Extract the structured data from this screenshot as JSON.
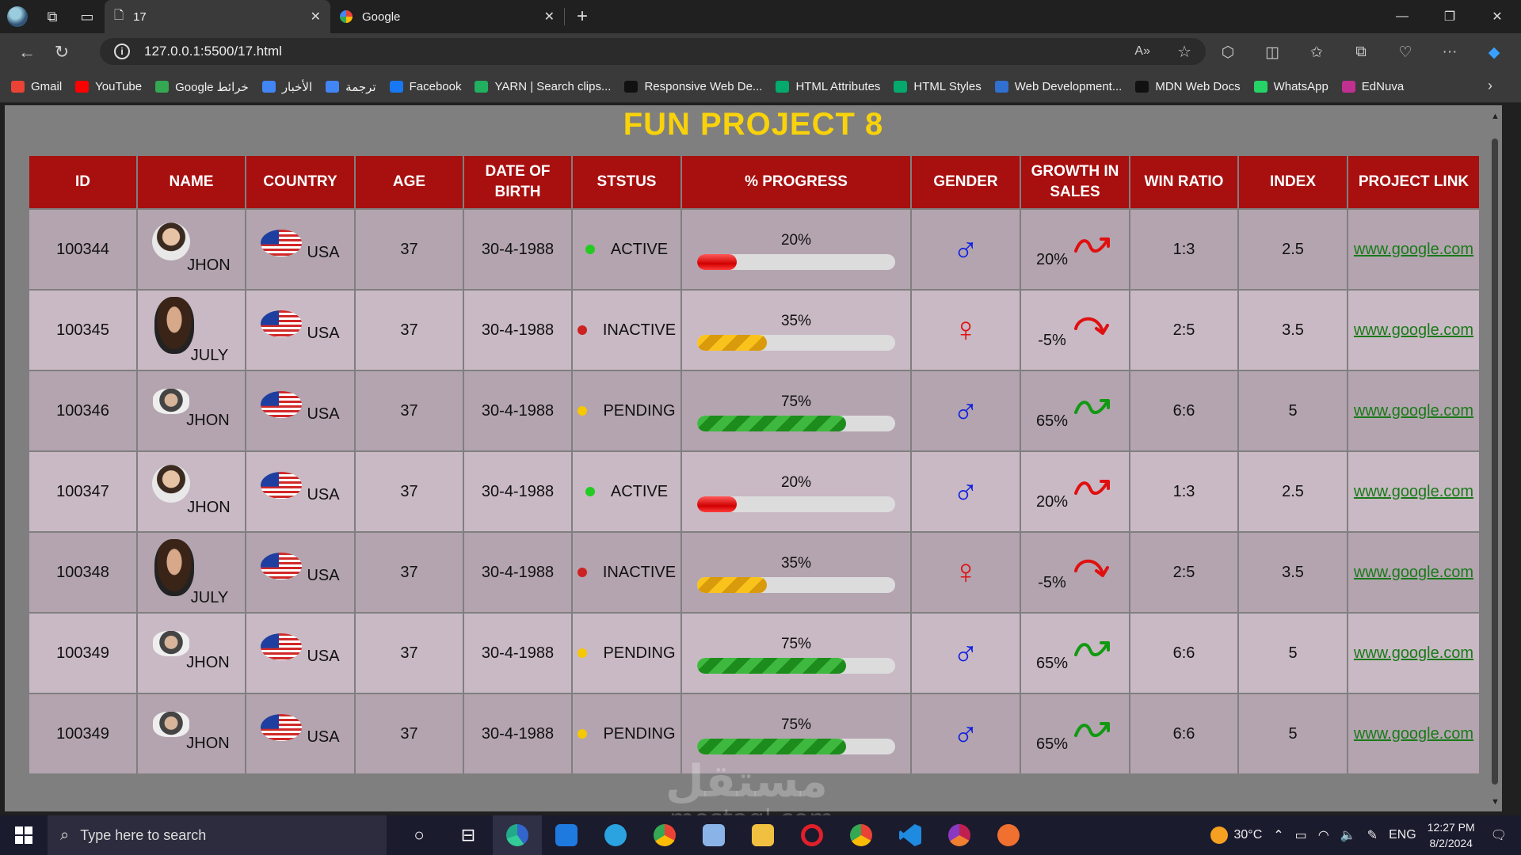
{
  "browser": {
    "tabs": [
      {
        "title": "17",
        "active": true
      },
      {
        "title": "Google",
        "active": false
      }
    ],
    "url": "127.0.0.1:5500/17.html",
    "bookmarks": [
      {
        "label": "Gmail",
        "color": "#ea4335"
      },
      {
        "label": "YouTube",
        "color": "#ff0000"
      },
      {
        "label": "Google خرائط",
        "color": "#34a853"
      },
      {
        "label": "الأخبار",
        "color": "#4285f4"
      },
      {
        "label": "ترجمة",
        "color": "#4285f4"
      },
      {
        "label": "Facebook",
        "color": "#1877f2"
      },
      {
        "label": "YARN | Search clips...",
        "color": "#20b060"
      },
      {
        "label": "Responsive Web De...",
        "color": "#111111"
      },
      {
        "label": "HTML Attributes",
        "color": "#04aa6d"
      },
      {
        "label": "HTML Styles",
        "color": "#04aa6d"
      },
      {
        "label": "Web Development...",
        "color": "#3070d0"
      },
      {
        "label": "MDN Web Docs",
        "color": "#111111"
      },
      {
        "label": "WhatsApp",
        "color": "#25d366"
      },
      {
        "label": "EdNuva",
        "color": "#c03090"
      }
    ]
  },
  "page": {
    "title": "FUN PROJECT 8",
    "headers": [
      "ID",
      "NAME",
      "COUNTRY",
      "AGE",
      "DATE OF BIRTH",
      "STSTUS",
      "% PROGRESS",
      "GENDER",
      "GROWTH IN SALES",
      "WIN RATIO",
      "INDEX",
      "PROJECT LINK"
    ],
    "rows": [
      {
        "id": "100344",
        "name": "JHON",
        "country": "USA",
        "age": "37",
        "dob": "30-4-1988",
        "status": "ACTIVE",
        "status_color": "#22cc22",
        "progress_label": "20%",
        "progress": 20,
        "progress_color": "red",
        "gender": "male",
        "gender_symbol": "♂",
        "growth": "20%",
        "growth_trend": "up-red",
        "win_ratio": "1:3",
        "index": "2.5",
        "link": "www.google.com",
        "avatar": "round"
      },
      {
        "id": "100345",
        "name": "JULY",
        "country": "USA",
        "age": "37",
        "dob": "30-4-1988",
        "status": "INACTIVE",
        "status_color": "#cc2222",
        "progress_label": "35%",
        "progress": 35,
        "progress_color": "yellow",
        "gender": "female",
        "gender_symbol": "♀",
        "growth": "-5%",
        "growth_trend": "down-red",
        "win_ratio": "2:5",
        "index": "3.5",
        "link": "www.google.com",
        "avatar": "big"
      },
      {
        "id": "100346",
        "name": "JHON",
        "country": "USA",
        "age": "37",
        "dob": "30-4-1988",
        "status": "PENDING",
        "status_color": "#f5c800",
        "progress_label": "75%",
        "progress": 75,
        "progress_color": "green",
        "gender": "male",
        "gender_symbol": "♂",
        "growth": "65%",
        "growth_trend": "up-green",
        "win_ratio": "6:6",
        "index": "5",
        "link": "www.google.com",
        "avatar": "wide"
      },
      {
        "id": "100347",
        "name": "JHON",
        "country": "USA",
        "age": "37",
        "dob": "30-4-1988",
        "status": "ACTIVE",
        "status_color": "#22cc22",
        "progress_label": "20%",
        "progress": 20,
        "progress_color": "red",
        "gender": "male",
        "gender_symbol": "♂",
        "growth": "20%",
        "growth_trend": "up-red",
        "win_ratio": "1:3",
        "index": "2.5",
        "link": "www.google.com",
        "avatar": "round"
      },
      {
        "id": "100348",
        "name": "JULY",
        "country": "USA",
        "age": "37",
        "dob": "30-4-1988",
        "status": "INACTIVE",
        "status_color": "#cc2222",
        "progress_label": "35%",
        "progress": 35,
        "progress_color": "yellow",
        "gender": "female",
        "gender_symbol": "♀",
        "growth": "-5%",
        "growth_trend": "down-red",
        "win_ratio": "2:5",
        "index": "3.5",
        "link": "www.google.com",
        "avatar": "big"
      },
      {
        "id": "100349",
        "name": "JHON",
        "country": "USA",
        "age": "37",
        "dob": "30-4-1988",
        "status": "PENDING",
        "status_color": "#f5c800",
        "progress_label": "75%",
        "progress": 75,
        "progress_color": "green",
        "gender": "male",
        "gender_symbol": "♂",
        "growth": "65%",
        "growth_trend": "up-green",
        "win_ratio": "6:6",
        "index": "5",
        "link": "www.google.com",
        "avatar": "wide"
      },
      {
        "id": "100349",
        "name": "JHON",
        "country": "USA",
        "age": "37",
        "dob": "30-4-1988",
        "status": "PENDING",
        "status_color": "#f5c800",
        "progress_label": "75%",
        "progress": 75,
        "progress_color": "green",
        "gender": "male",
        "gender_symbol": "♂",
        "growth": "65%",
        "growth_trend": "up-green",
        "win_ratio": "6:6",
        "index": "5",
        "link": "www.google.com",
        "avatar": "wide"
      }
    ],
    "watermark": "مستقل",
    "watermark_sub": "mostaql.com"
  },
  "taskbar": {
    "search_placeholder": "Type here to search",
    "temperature": "30°C",
    "language": "ENG",
    "time": "12:27 PM",
    "date": "8/2/2024"
  }
}
